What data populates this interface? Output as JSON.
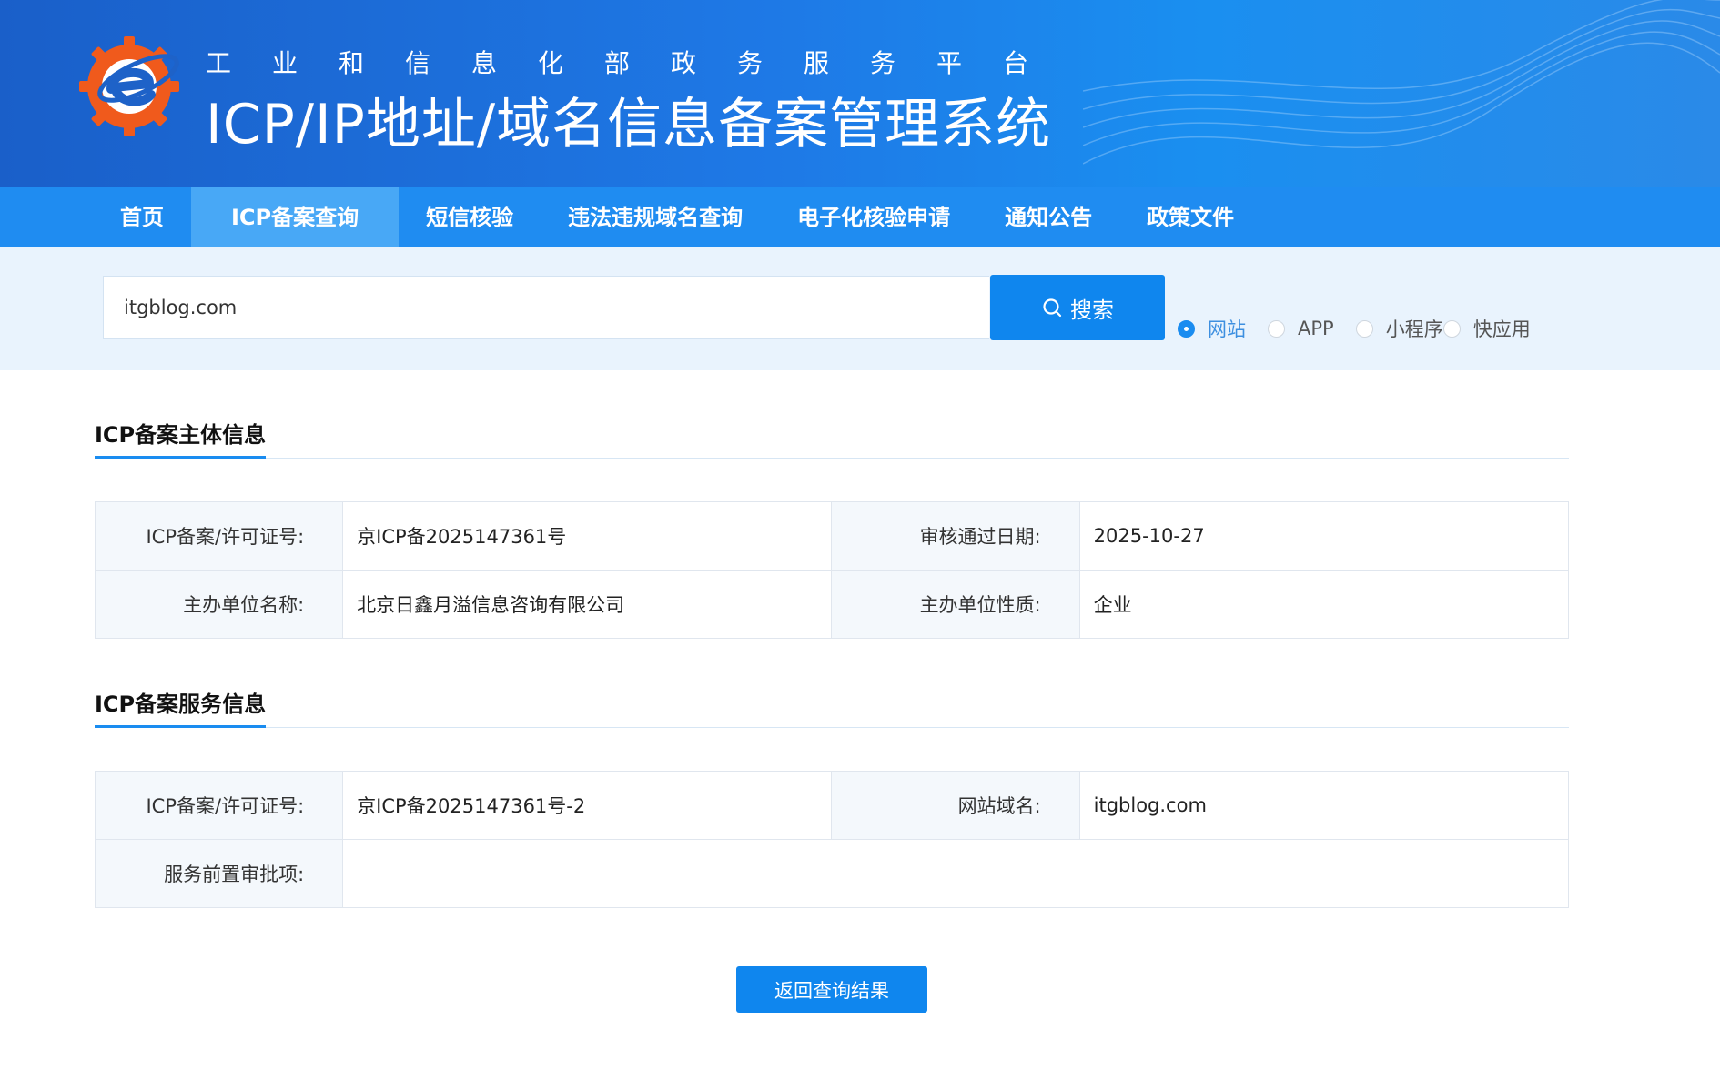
{
  "header": {
    "subtitle": "工业和信息化部政务服务平台",
    "title": "ICP/IP地址/域名信息备案管理系统"
  },
  "nav": {
    "items": [
      "首页",
      "ICP备案查询",
      "短信核验",
      "违法违规域名查询",
      "电子化核验申请",
      "通知公告",
      "政策文件"
    ],
    "active_index": 1
  },
  "search": {
    "value": "itgblog.com",
    "button_label": "搜索",
    "types": [
      {
        "label": "网站",
        "checked": true
      },
      {
        "label": "APP",
        "checked": false
      },
      {
        "label": "小程序",
        "checked": false
      },
      {
        "label": "快应用",
        "checked": false
      }
    ]
  },
  "entity_section": {
    "title": "ICP备案主体信息",
    "rows": [
      [
        {
          "key": "ICP备案/许可证号:",
          "value": "京ICP备2025147361号"
        },
        {
          "key": "审核通过日期:",
          "value": "2025-10-27"
        }
      ],
      [
        {
          "key": "主办单位名称:",
          "value": "北京日鑫月溢信息咨询有限公司"
        },
        {
          "key": "主办单位性质:",
          "value": "企业"
        }
      ]
    ]
  },
  "service_section": {
    "title": "ICP备案服务信息",
    "rows": [
      [
        {
          "key": "ICP备案/许可证号:",
          "value": "京ICP备2025147361号-2"
        },
        {
          "key": "网站域名:",
          "value": "itgblog.com"
        }
      ]
    ],
    "pre_approval": {
      "key": "服务前置审批项:",
      "value": ""
    }
  },
  "back_button_label": "返回查询结果",
  "colors": {
    "primary": "#0f86ee",
    "nav_bg": "#1f8cf1",
    "nav_active": "#48a8f6",
    "band_bg": "#e9f3fd"
  }
}
